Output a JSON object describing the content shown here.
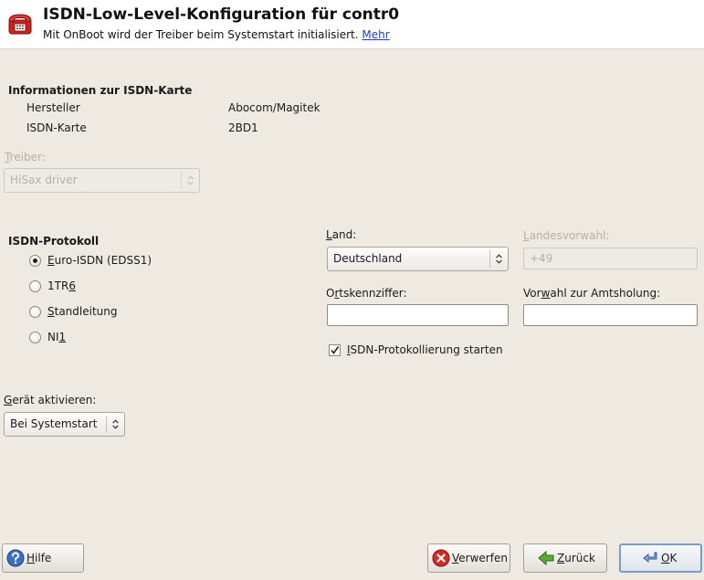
{
  "header": {
    "title": "ISDN-Low-Level-Konfiguration für contr0",
    "subtitle": "Mit OnBoot wird der Treiber beim Systemstart initialisiert.",
    "more_link": "Mehr"
  },
  "card_info": {
    "title": "Informationen zur ISDN-Karte",
    "vendor_label": "Hersteller",
    "vendor_value": "Abocom/Magitek",
    "card_label": "ISDN-Karte",
    "card_value": "2BD1"
  },
  "driver": {
    "label": "Treiber:",
    "value": "HiSax driver"
  },
  "protocol": {
    "title": "ISDN-Protokoll",
    "options": [
      {
        "label": "Euro-ISDN (EDSS1)",
        "selected": true
      },
      {
        "label": "1TR6",
        "selected": false
      },
      {
        "label": "Standleitung",
        "selected": false
      },
      {
        "label": "NI1",
        "selected": false
      }
    ]
  },
  "country": {
    "label": "Land:",
    "value": "Deutschland"
  },
  "area_code": {
    "label": "Landesvorwahl:",
    "value": "+49"
  },
  "local_code": {
    "label": "Ortskennziffer:",
    "value": ""
  },
  "outside_line": {
    "label": "Vorwahl zur Amtsholung:",
    "value": ""
  },
  "logging": {
    "label": "ISDN-Protokollierung starten",
    "checked": true
  },
  "activate": {
    "label": "Gerät aktivieren:",
    "value": "Bei Systemstart"
  },
  "buttons": {
    "help": "Hilfe",
    "discard": "Verwerfen",
    "back": "Zurück",
    "ok": "OK"
  }
}
